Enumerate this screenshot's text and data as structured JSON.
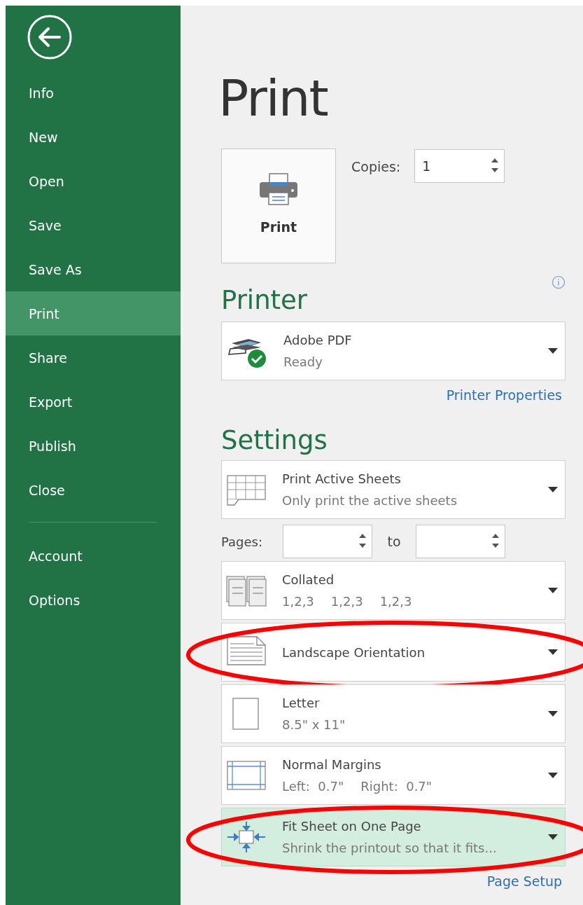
{
  "sidebar": {
    "items": [
      {
        "label": "Info",
        "selected": false
      },
      {
        "label": "New",
        "selected": false
      },
      {
        "label": "Open",
        "selected": false
      },
      {
        "label": "Save",
        "selected": false
      },
      {
        "label": "Save As",
        "selected": false
      },
      {
        "label": "Print",
        "selected": true
      },
      {
        "label": "Share",
        "selected": false
      },
      {
        "label": "Export",
        "selected": false
      },
      {
        "label": "Publish",
        "selected": false
      },
      {
        "label": "Close",
        "selected": false
      }
    ],
    "bottom_items": [
      {
        "label": "Account",
        "selected": false
      },
      {
        "label": "Options",
        "selected": false
      }
    ]
  },
  "title": "Print",
  "print_button": {
    "label": "Print"
  },
  "copies": {
    "label": "Copies:",
    "value": "1"
  },
  "printer": {
    "heading": "Printer",
    "name": "Adobe PDF",
    "status": "Ready",
    "ready": true,
    "properties_link": "Printer Properties"
  },
  "settings": {
    "heading": "Settings",
    "rows": [
      {
        "kind": "sheets",
        "title": "Print Active Sheets",
        "subtitle": [
          "Only print the active sheets"
        ],
        "highlighted": false,
        "circled": false
      },
      {
        "kind": "pages",
        "label": "Pages:",
        "to_label": "to"
      },
      {
        "kind": "collated",
        "title": "Collated",
        "subtitle": [
          "1,2,3",
          "1,2,3",
          "1,2,3"
        ],
        "highlighted": false,
        "circled": false
      },
      {
        "kind": "orientation",
        "title": "Landscape Orientation",
        "highlighted": false,
        "circled": true
      },
      {
        "kind": "paper",
        "title": "Letter",
        "subtitle": [
          "8.5\" x 11\""
        ],
        "highlighted": false,
        "circled": false
      },
      {
        "kind": "margins",
        "title": "Normal Margins",
        "subtitle": [
          "Left:  0.7\"",
          "Right:  0.7\""
        ],
        "highlighted": false,
        "circled": false
      },
      {
        "kind": "scaling",
        "title": "Fit Sheet on One Page",
        "subtitle": [
          "Shrink the printout so that it fits..."
        ],
        "highlighted": true,
        "circled": true
      }
    ],
    "page_setup_link": "Page Setup"
  }
}
